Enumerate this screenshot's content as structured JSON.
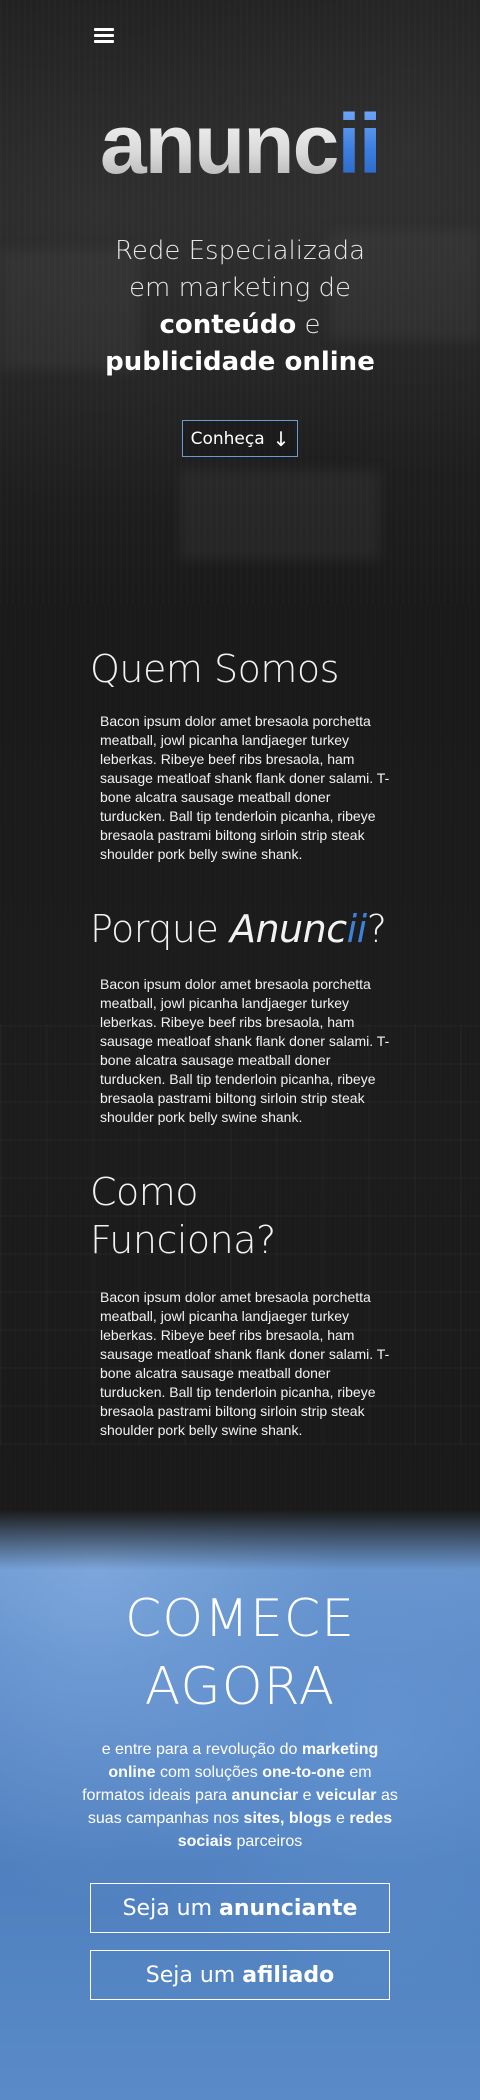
{
  "header": {
    "menu_icon": "hamburger-menu-icon",
    "logo": {
      "plain": "anunc",
      "accent": "ii",
      "accent_color": "#3d82d8"
    }
  },
  "hero": {
    "tagline": {
      "line1": "Rede Especializada",
      "line2": "em marketing de",
      "bold1": "conteúdo",
      "join": "e",
      "bold2": "publicidade online"
    },
    "cta_label": "Conheça",
    "cta_icon": "arrow-down-icon",
    "cta_arrow": "↓"
  },
  "sections": {
    "about": {
      "title": "Quem Somos",
      "text": "Bacon ipsum dolor amet bresaola porchetta meatball, jowl picanha landjaeger turkey leberkas. Ribeye beef ribs bresaola, ham sausage meatloaf shank flank doner salami. T-bone alcatra sausage meatball doner turducken. Ball tip tenderloin picanha, ribeye bresaola pastrami biltong sirloin strip steak shoulder pork belly swine shank."
    },
    "why": {
      "title_prefix": "Porque",
      "title_brand": "Anunc",
      "title_brand_accent": "ii",
      "title_suffix": "?",
      "text": "Bacon ipsum dolor amet bresaola porchetta meatball, jowl picanha landjaeger turkey leberkas. Ribeye beef ribs bresaola, ham sausage meatloaf shank flank doner salami. T-bone alcatra sausage meatball doner turducken. Ball tip tenderloin picanha, ribeye bresaola pastrami biltong sirloin strip steak shoulder pork belly swine shank."
    },
    "how": {
      "title_line1": "Como",
      "title_line2": "Funciona?",
      "text": "Bacon ipsum dolor amet bresaola porchetta meatball, jowl picanha landjaeger turkey leberkas. Ribeye beef ribs bresaola, ham sausage meatloaf shank flank doner salami. T-bone alcatra sausage meatball doner turducken. Ball tip tenderloin picanha, ribeye bresaola pastrami biltong sirloin strip steak shoulder pork belly swine shank."
    }
  },
  "start": {
    "title_line1": "COMECE",
    "title_line2": "AGORA",
    "text": {
      "t1": "e entre para a revolução do",
      "b1": "marketing online",
      "t2": "com soluções",
      "b2": "one-to-one",
      "t3": "em formatos ideais para",
      "b3": "anunciar",
      "t4": "e",
      "b4": "veicular",
      "t5": "as suas campanhas nos",
      "b5": "sites, blogs",
      "t6": "e",
      "b6": "redes sociais",
      "t7": "parceiros"
    },
    "advertiser_button": {
      "prefix": "Seja um",
      "bold": "anunciante"
    },
    "affiliate_button": {
      "prefix": "Seja um",
      "bold": "afiliado"
    },
    "background_color": "#5b89c6"
  }
}
